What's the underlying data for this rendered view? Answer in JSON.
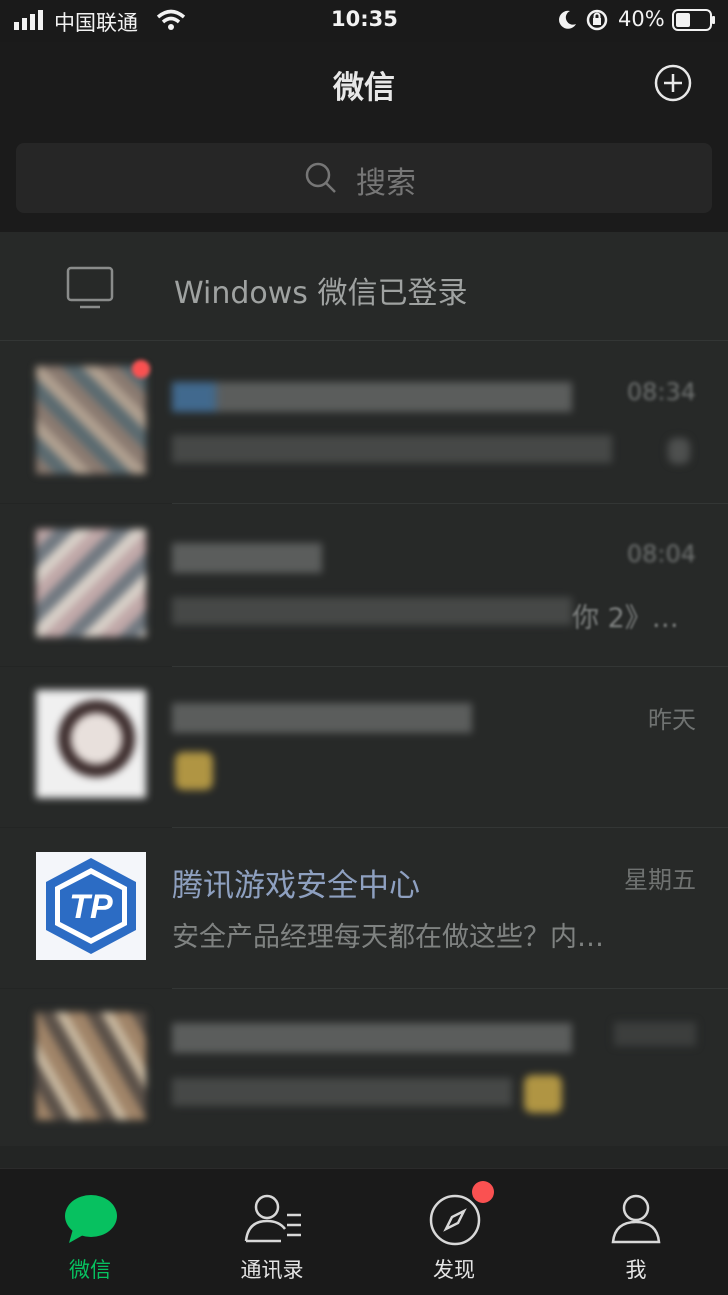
{
  "status_bar": {
    "carrier": "中国联通",
    "time": "10:35",
    "battery": "40%"
  },
  "header": {
    "title": "微信",
    "add_icon": "plus-circle-icon"
  },
  "search": {
    "placeholder": "搜索"
  },
  "login_notice": {
    "text": "Windows 微信已登录",
    "icon": "monitor-icon"
  },
  "chats": [
    {
      "name": "腾讯游戏安全中心",
      "message": "安全产品经理每天都在做这些？内…",
      "time": "星期五"
    }
  ],
  "blurred_times": [
    "08:34",
    "08:04",
    "昨天"
  ],
  "blurred_fragments": {
    "row2_msg_tail": "你 2》…"
  },
  "tabs": [
    {
      "label": "微信",
      "icon": "chat-bubble-icon",
      "active": true
    },
    {
      "label": "通讯录",
      "icon": "contacts-icon"
    },
    {
      "label": "发现",
      "icon": "compass-icon",
      "badge": true
    },
    {
      "label": "我",
      "icon": "person-icon"
    }
  ],
  "colors": {
    "accent": "#07c160",
    "badge": "#fa5151",
    "background": "#232524"
  }
}
